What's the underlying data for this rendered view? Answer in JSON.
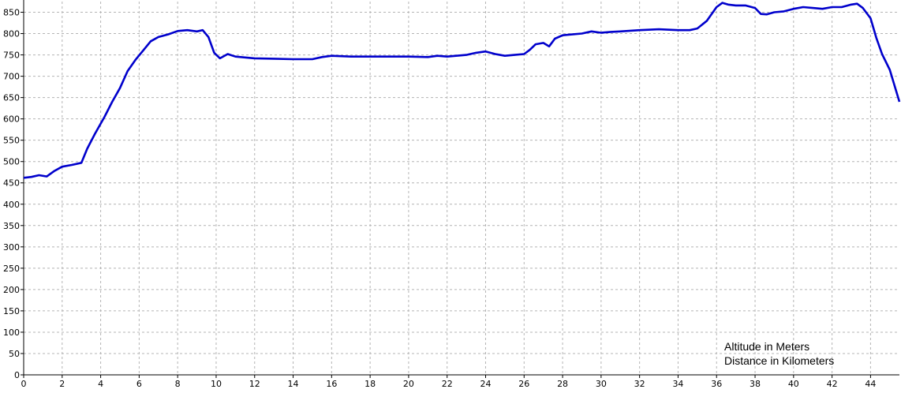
{
  "chart_data": {
    "type": "line",
    "title": "",
    "annotations": [
      "Altitude in Meters",
      "Distance in Kilometers"
    ],
    "xlabel": "",
    "ylabel": "",
    "xlim": [
      0,
      45.5
    ],
    "ylim": [
      0,
      875
    ],
    "x_ticks": [
      0,
      2,
      4,
      6,
      8,
      10,
      12,
      14,
      16,
      18,
      20,
      22,
      24,
      26,
      28,
      30,
      32,
      34,
      36,
      38,
      40,
      42,
      44
    ],
    "y_ticks": [
      0,
      50,
      100,
      150,
      200,
      250,
      300,
      350,
      400,
      450,
      500,
      550,
      600,
      650,
      700,
      750,
      800,
      850
    ],
    "grid": true,
    "line_color": "#0000cc",
    "series": [
      {
        "x": [
          0,
          0.4,
          0.8,
          1.2,
          1.6,
          2.0,
          2.5,
          3.0,
          3.3,
          3.7,
          4.2,
          4.6,
          5.0,
          5.4,
          5.8,
          6.2,
          6.6,
          7.0,
          7.5,
          8.0,
          8.5,
          9.0,
          9.3,
          9.6,
          9.9,
          10.2,
          10.6,
          11.0,
          11.5,
          12.0,
          13.0,
          14.0,
          15.0,
          15.5,
          16.0,
          17.0,
          18.0,
          19.0,
          20.0,
          21.0,
          21.5,
          22.0,
          23.0,
          23.5,
          24.0,
          24.5,
          25.0,
          25.5,
          26.0,
          26.3,
          26.6,
          27.0,
          27.3,
          27.6,
          28.0,
          28.5,
          29.0,
          29.5,
          30.0,
          30.5,
          31.0,
          32.0,
          33.0,
          34.0,
          34.6,
          35.0,
          35.5,
          36.0,
          36.3,
          36.6,
          37.0,
          37.5,
          38.0,
          38.3,
          38.6,
          39.0,
          39.5,
          40.0,
          40.5,
          41.0,
          41.5,
          42.0,
          42.5,
          43.0,
          43.3,
          43.6,
          44.0,
          44.3,
          44.6,
          45.0,
          45.3,
          45.5
        ],
        "values": [
          462,
          464,
          468,
          465,
          478,
          488,
          492,
          497,
          530,
          565,
          605,
          640,
          672,
          712,
          738,
          760,
          782,
          792,
          798,
          806,
          808,
          805,
          808,
          792,
          755,
          742,
          752,
          746,
          744,
          742,
          741,
          740,
          740,
          745,
          748,
          746,
          746,
          746,
          746,
          745,
          748,
          746,
          750,
          755,
          758,
          752,
          748,
          750,
          752,
          762,
          775,
          778,
          770,
          788,
          796,
          798,
          800,
          805,
          802,
          804,
          805,
          808,
          810,
          808,
          808,
          812,
          830,
          862,
          872,
          868,
          866,
          866,
          860,
          846,
          845,
          850,
          852,
          858,
          862,
          860,
          858,
          862,
          862,
          868,
          870,
          860,
          836,
          790,
          752,
          715,
          670,
          640
        ]
      }
    ]
  }
}
